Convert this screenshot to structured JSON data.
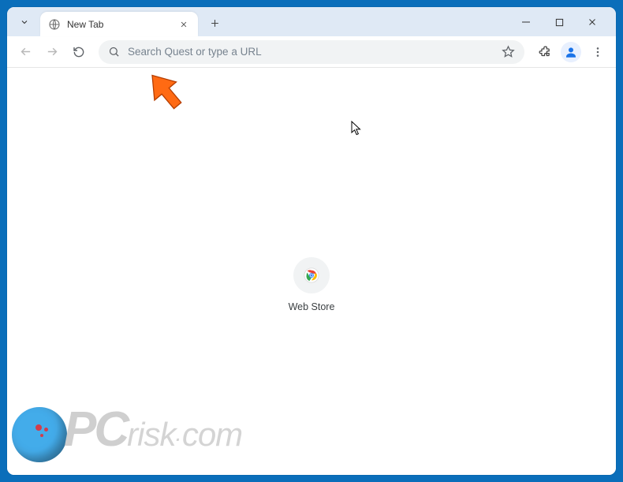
{
  "window": {
    "minimize_tip": "Minimize",
    "maximize_tip": "Maximize",
    "close_tip": "Close"
  },
  "tabstrip": {
    "search_tabs_tip": "Search tabs",
    "active_tab_title": "New Tab",
    "close_tab_tip": "Close",
    "new_tab_tip": "New Tab"
  },
  "toolbar": {
    "back_tip": "Back",
    "forward_tip": "Forward",
    "reload_tip": "Reload",
    "omnibox_placeholder": "Search Quest or type a URL",
    "omnibox_value": "",
    "bookmark_tip": "Bookmark this tab",
    "extensions_tip": "Extensions",
    "profile_tip": "Profile",
    "menu_tip": "Customize and control"
  },
  "content": {
    "shortcut_label": "Web Store"
  },
  "watermark": {
    "text_pc": "PC",
    "text_risk": "risk",
    "text_dot": ".",
    "text_com": "com"
  }
}
